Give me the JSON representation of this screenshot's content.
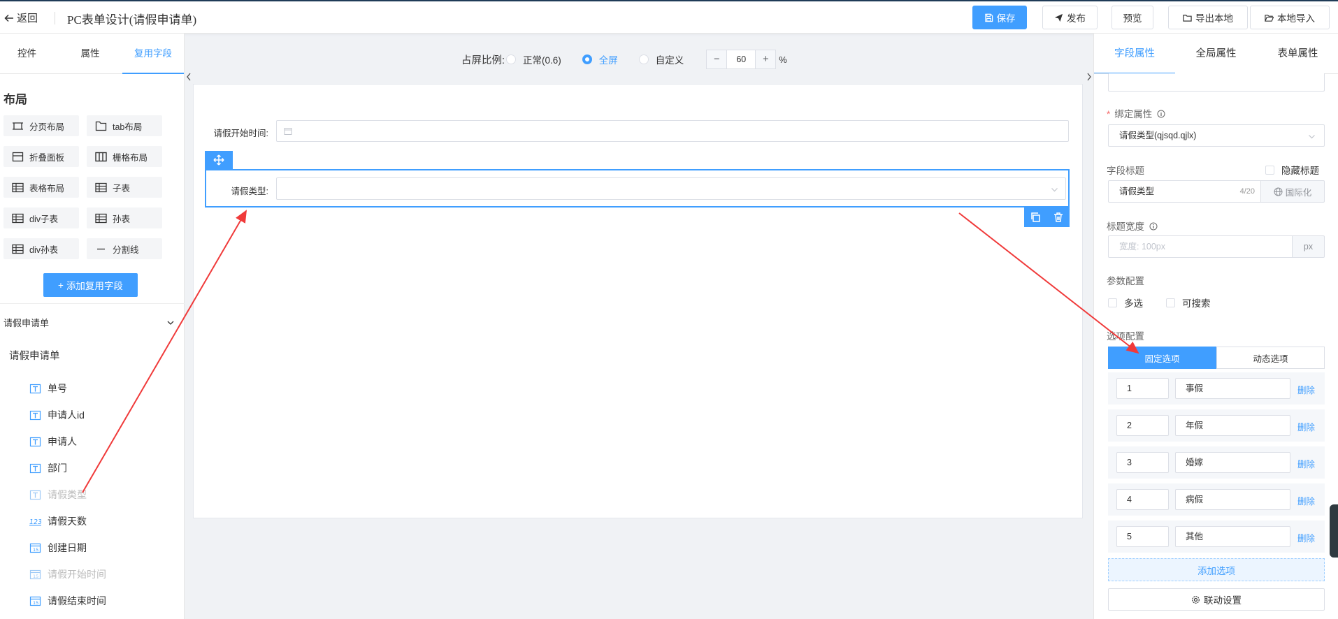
{
  "topbar": {
    "back_label": "返回",
    "title": "PC表单设计(请假申请单)",
    "buttons": {
      "save": "保存",
      "publish": "发布",
      "preview": "预览",
      "export": "导出本地",
      "import": "本地导入"
    }
  },
  "left": {
    "tabs": [
      "控件",
      "属性",
      "复用字段"
    ],
    "active_tab": "复用字段",
    "layout_title": "布局",
    "components": [
      "分页布局",
      "tab布局",
      "折叠面板",
      "栅格布局",
      "表格布局",
      "子表",
      "div子表",
      "孙表",
      "div孙表",
      "分割线"
    ],
    "add_button": "添加复用字段",
    "group_title": "请假申请单",
    "group_sub": "请假申请单",
    "fields": [
      {
        "label": "单号",
        "icon": "text-icon",
        "disabled": false
      },
      {
        "label": "申请人id",
        "icon": "text-icon",
        "disabled": false
      },
      {
        "label": "申请人",
        "icon": "text-icon",
        "disabled": false
      },
      {
        "label": "部门",
        "icon": "text-icon",
        "disabled": false
      },
      {
        "label": "请假类型",
        "icon": "text-icon",
        "disabled": true
      },
      {
        "label": "请假天数",
        "icon": "number-icon",
        "disabled": false
      },
      {
        "label": "创建日期",
        "icon": "date-icon",
        "disabled": false
      },
      {
        "label": "请假开始时间",
        "icon": "date-icon",
        "disabled": true
      },
      {
        "label": "请假结束时间",
        "icon": "date-icon",
        "disabled": false
      }
    ]
  },
  "canvas": {
    "ratio_label": "占屏比例:",
    "ratio_options": [
      "正常(0.6)",
      "全屏",
      "自定义"
    ],
    "ratio_selected": "全屏",
    "zoom_value": "60",
    "zoom_unit": "%",
    "zoom_minus": "−",
    "zoom_plus": "+",
    "fields": [
      {
        "label": "请假开始时间:"
      },
      {
        "label": "请假类型:"
      }
    ]
  },
  "right": {
    "tabs": [
      "字段属性",
      "全局属性",
      "表单属性"
    ],
    "active_tab": "字段属性",
    "bind_label": "绑定属性",
    "bind_value": "请假类型(qjsqd.qjlx)",
    "title_label": "字段标题",
    "hide_title": "隐藏标题",
    "title_value": "请假类型",
    "title_count": "4/20",
    "i18n": "国际化",
    "width_label": "标题宽度",
    "width_placeholder": "宽度: 100px",
    "width_unit": "px",
    "param_label": "参数配置",
    "multi": "多选",
    "searchable": "可搜索",
    "option_label": "选项配置",
    "option_modes": [
      "固定选项",
      "动态选项"
    ],
    "option_mode_selected": "固定选项",
    "options": [
      {
        "value": "1",
        "label": "事假"
      },
      {
        "value": "2",
        "label": "年假"
      },
      {
        "value": "3",
        "label": "婚嫁"
      },
      {
        "value": "4",
        "label": "病假"
      },
      {
        "value": "5",
        "label": "其他"
      }
    ],
    "delete_label": "删除",
    "add_option": "添加选项",
    "linkage": "联动设置"
  },
  "colors": {
    "primary": "#409eff",
    "annotation_arrow": "#f03a3a"
  }
}
